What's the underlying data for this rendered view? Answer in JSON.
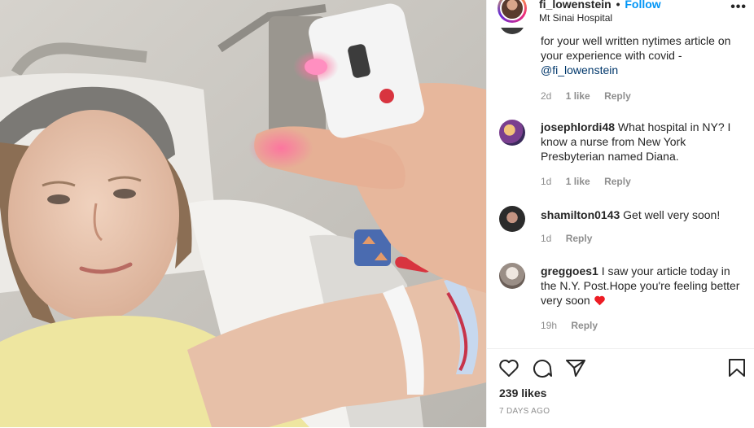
{
  "post": {
    "username": "fi_lowenstein",
    "separator": "•",
    "follow_label": "Follow",
    "location": "Mt Sinai Hospital",
    "more_label": "•••"
  },
  "comments": [
    {
      "username": "",
      "text": "for your well written nytimes article on your experience with covid -",
      "mention": "@fi_lowenstein",
      "time": "2d",
      "likes": "1 like",
      "reply_label": "Reply"
    },
    {
      "username": "josephlordi48",
      "text": "What hospital in NY? I know a nurse from New York Presbyterian named Diana.",
      "time": "1d",
      "likes": "1 like",
      "reply_label": "Reply"
    },
    {
      "username": "shamilton0143",
      "text": "Get well very soon!",
      "time": "1d",
      "reply_label": "Reply"
    },
    {
      "username": "greggoes1",
      "text": "I saw your article today in the N.Y. Post.Hope you're feeling better very soon",
      "time": "19h",
      "reply_label": "Reply"
    }
  ],
  "icons": {
    "like": "heart-outline-icon",
    "comment": "comment-bubble-icon",
    "share": "paper-plane-icon",
    "save": "bookmark-icon",
    "emoji": "red-heart-emoji"
  },
  "footer": {
    "likes": "239 likes",
    "timestamp": "7 DAYS AGO"
  },
  "colors": {
    "link_blue": "#0095f6",
    "text": "#262626",
    "muted": "#8e8e8e",
    "heart_red": "#ed4956"
  }
}
